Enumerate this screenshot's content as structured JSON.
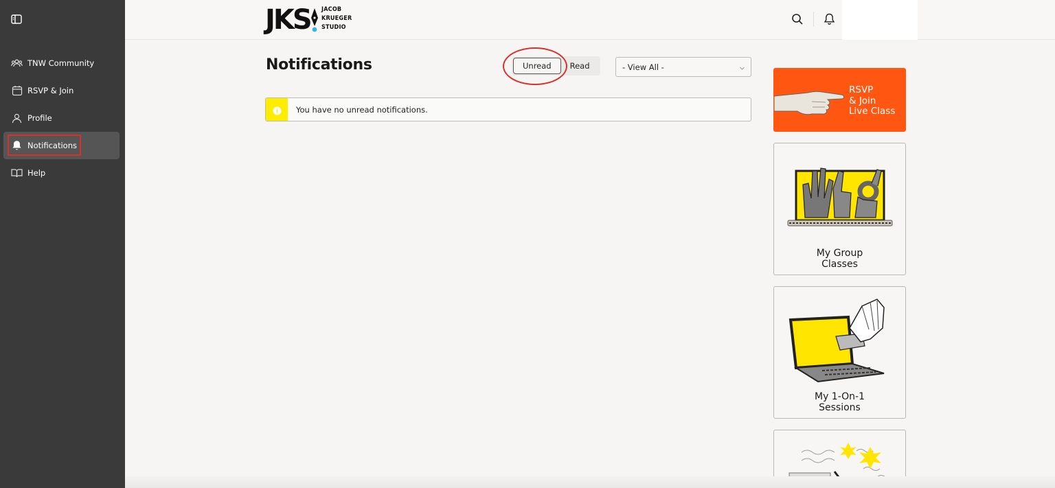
{
  "sidebar": {
    "items": [
      {
        "label": "TNW Community",
        "icon": "community-icon"
      },
      {
        "label": "RSVP & Join",
        "icon": "calendar-icon"
      },
      {
        "label": "Profile",
        "icon": "user-icon"
      },
      {
        "label": "Notifications",
        "icon": "bell-icon",
        "active": true
      },
      {
        "label": "Help",
        "icon": "book-icon"
      }
    ]
  },
  "header": {
    "logo_main": "JKS",
    "logo_sub": [
      "JACOB",
      "KRUEGER",
      "STUDIO"
    ]
  },
  "main": {
    "title": "Notifications",
    "tabs": [
      {
        "label": "Unread",
        "active": true
      },
      {
        "label": "Read",
        "active": false
      }
    ],
    "view_select": {
      "selected": "- View All -"
    },
    "notice": {
      "text": "You have no unread notifications."
    }
  },
  "cards": {
    "rsvp": {
      "lines": [
        "RSVP",
        "& Join",
        "Live Class"
      ]
    },
    "group": {
      "lines": [
        "My Group",
        "Classes"
      ]
    },
    "one_on_one": {
      "lines": [
        "My 1-On-1",
        "Sessions"
      ]
    }
  },
  "colors": {
    "sidebar_bg": "#3a3a3a",
    "accent_orange": "#ff5712",
    "accent_yellow": "#ffed00",
    "annotation_red": "#d9302c"
  }
}
